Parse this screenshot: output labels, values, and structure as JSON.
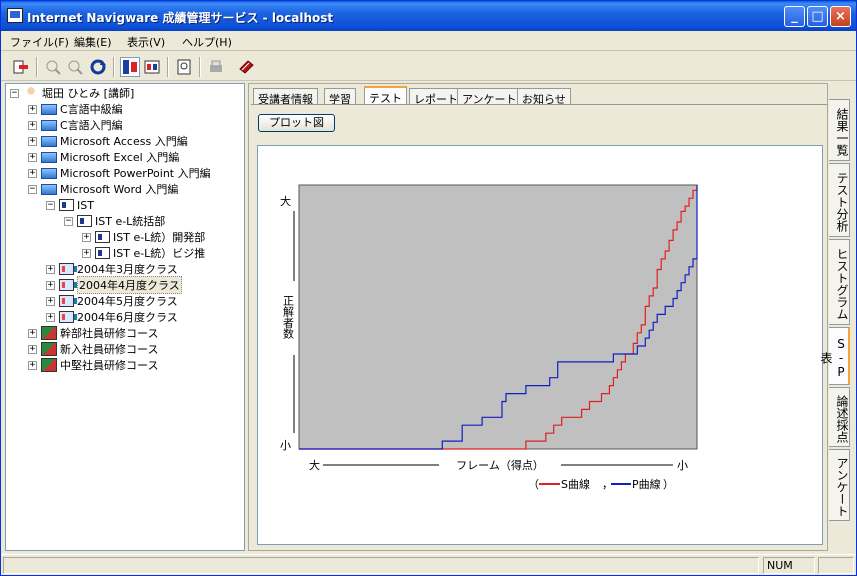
{
  "window": {
    "title": "Internet Navigware 成績管理サービス - localhost",
    "controls": {
      "minimize": "_",
      "maximize": "□",
      "close": "×"
    }
  },
  "menu": [
    "ファイル(F)",
    "編集(E)",
    "表示(V)",
    "ヘルプ(H)"
  ],
  "tree": [
    {
      "label": "堀田 ひとみ [講師]",
      "icon": "user-icon",
      "exp": "−"
    },
    {
      "label": "C言語中級編",
      "icon": "course-pc-icon",
      "exp": "+"
    },
    {
      "label": "C言語入門編",
      "icon": "course-pc-icon",
      "exp": "+"
    },
    {
      "label": "Microsoft Access 入門編",
      "icon": "course-pc-icon",
      "exp": "+"
    },
    {
      "label": "Microsoft Excel 入門編",
      "icon": "course-pc-icon",
      "exp": "+"
    },
    {
      "label": "Microsoft PowerPoint 入門編",
      "icon": "course-pc-icon",
      "exp": "+"
    },
    {
      "label": "Microsoft Word 入門編",
      "icon": "course-pc-icon",
      "exp": "−"
    },
    {
      "label": "IST",
      "icon": "org-card-icon",
      "exp": "−"
    },
    {
      "label": "IST e-L統括部",
      "icon": "org-card-icon",
      "exp": "−"
    },
    {
      "label": "IST e-L統）開発部",
      "icon": "org-card-icon",
      "exp": "+"
    },
    {
      "label": "IST e-L統）ビジ推",
      "icon": "org-card-icon",
      "exp": "+"
    },
    {
      "label": "2004年3月度クラス",
      "icon": "class-icon",
      "exp": "+"
    },
    {
      "label": "2004年4月度クラス",
      "icon": "class-icon",
      "exp": "+"
    },
    {
      "label": "2004年5月度クラス",
      "icon": "class-icon",
      "exp": "+"
    },
    {
      "label": "2004年6月度クラス",
      "icon": "class-icon",
      "exp": "+"
    },
    {
      "label": "幹部社員研修コース",
      "icon": "group-icon",
      "exp": "+"
    },
    {
      "label": "新入社員研修コース",
      "icon": "group-icon",
      "exp": "+"
    },
    {
      "label": "中堅社員研修コース",
      "icon": "group-icon",
      "exp": "+"
    }
  ],
  "tabs": [
    "受講者情報",
    "学習",
    "テスト",
    "レポート",
    "アンケート",
    "お知らせ"
  ],
  "active_tab": "テスト",
  "plot_button": "プロット図",
  "side_tabs": [
    "結果一覧",
    "テスト分析",
    "ヒストグラム",
    "S-P表",
    "論述採点",
    "アンケート"
  ],
  "active_side_tab": "S-P表",
  "status": {
    "num": "NUM"
  },
  "colors": {
    "s_curve": "#e02020",
    "p_curve": "#1020c0",
    "plot_bg": "#c0c0c0"
  },
  "chart_data": {
    "type": "line",
    "title": "",
    "ylabel": "正解者数",
    "xlabel": "フレーム（得点）",
    "y_high": "大",
    "y_low": "小",
    "x_left": "大",
    "x_right": "小",
    "xlim": [
      0,
      100
    ],
    "ylim": [
      0,
      100
    ],
    "legend_open": "（",
    "legend_close": "）",
    "legend_sep": "，",
    "series": [
      {
        "name": "S曲線",
        "style": "step",
        "x": [
          0,
          31,
          57,
          62,
          64,
          66,
          68,
          71,
          73,
          76,
          78,
          79,
          80,
          81,
          82,
          84,
          85,
          86,
          87,
          88,
          89,
          90,
          91,
          92,
          93,
          94,
          95,
          96,
          97,
          98,
          99,
          100
        ],
        "y": [
          0,
          0,
          3,
          6,
          9,
          12,
          12,
          15,
          18,
          21,
          24,
          27,
          30,
          33,
          36,
          40,
          44,
          47,
          54,
          58,
          61,
          68,
          72,
          75,
          79,
          83,
          86,
          90,
          92,
          95,
          98,
          100
        ]
      },
      {
        "name": "P曲線",
        "style": "step",
        "x": [
          0,
          31,
          36,
          41,
          46,
          51,
          52,
          57,
          63,
          65,
          76,
          79,
          85,
          87,
          88,
          89,
          90,
          91,
          92,
          93,
          94,
          95,
          96,
          97,
          98,
          99,
          100
        ],
        "y": [
          0,
          0,
          3,
          9,
          12,
          18,
          21,
          24,
          27,
          33,
          33,
          36,
          39,
          42,
          45,
          48,
          51,
          51,
          54,
          54,
          57,
          60,
          63,
          66,
          69,
          72,
          100
        ]
      }
    ]
  }
}
